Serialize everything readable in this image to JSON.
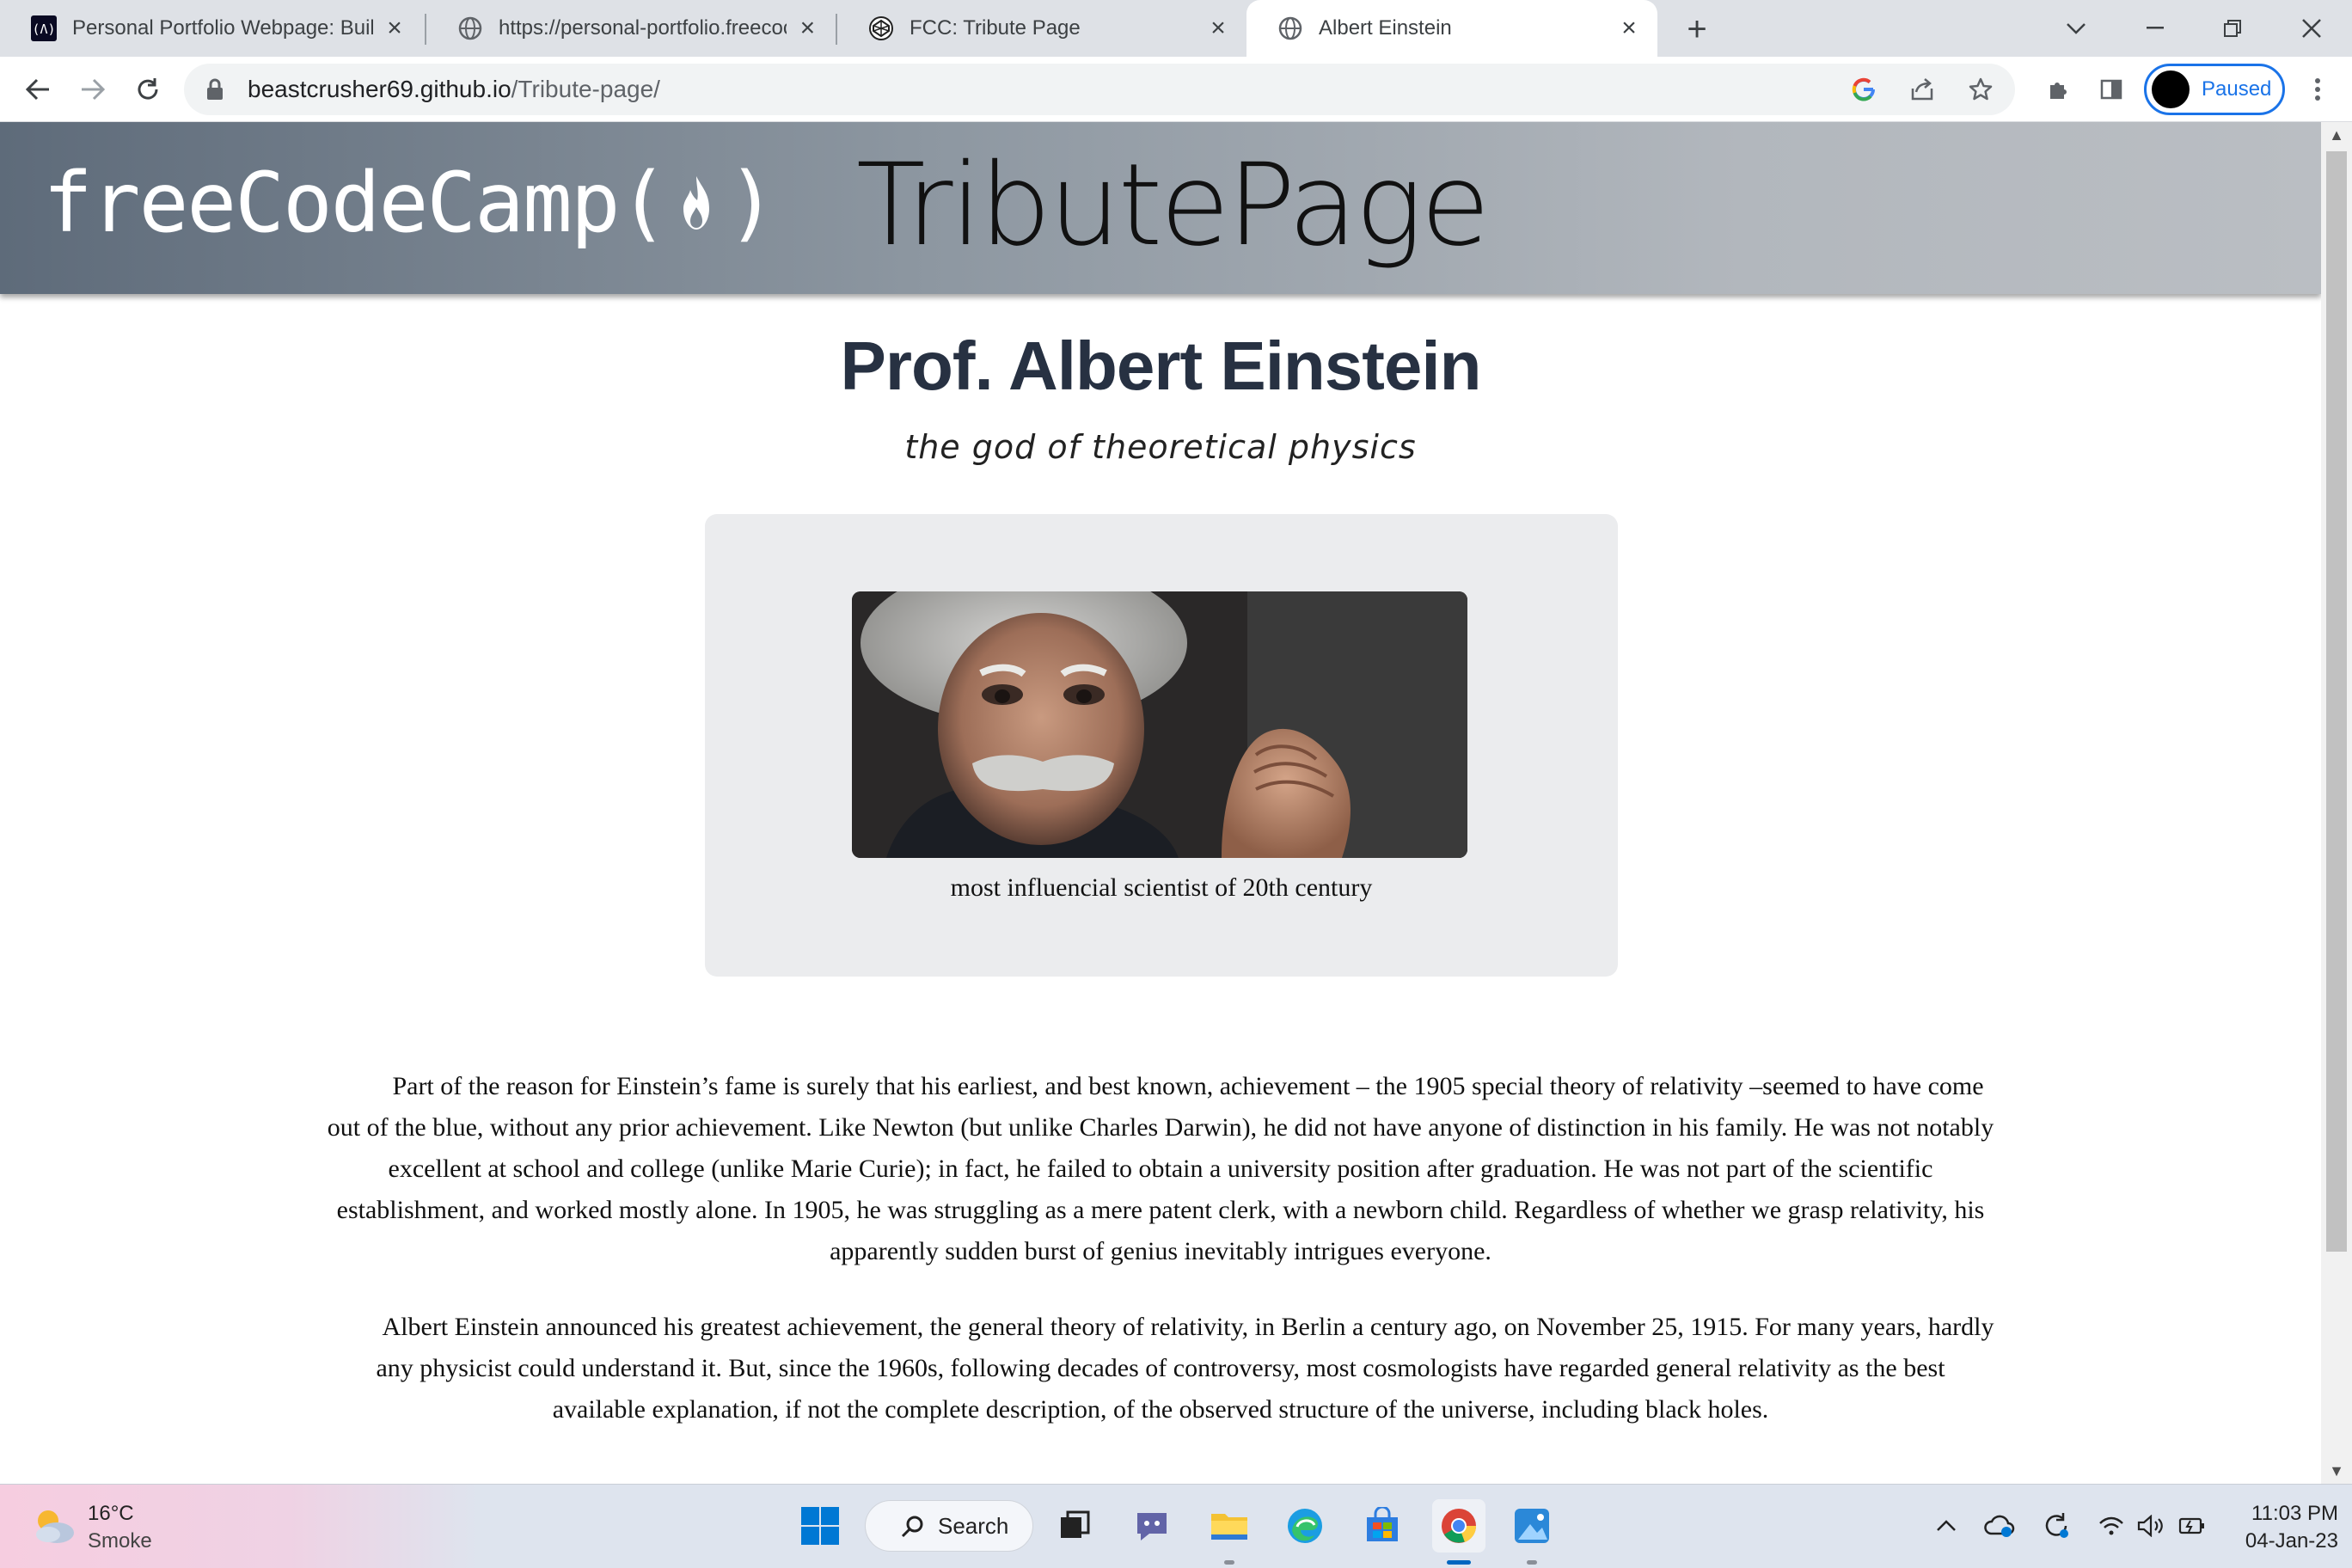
{
  "browser": {
    "tabs": [
      {
        "title": "Personal Portfolio Webpage: Buil",
        "icon": "freecodecamp-icon",
        "active": false
      },
      {
        "title": "https://personal-portfolio.freecoc",
        "icon": "globe-icon",
        "active": false
      },
      {
        "title": "FCC: Tribute Page",
        "icon": "codepen-icon",
        "active": false
      },
      {
        "title": "Albert Einstein",
        "icon": "globe-icon",
        "active": true
      }
    ],
    "url_host": "beastcrusher69.github.io",
    "url_path": "/Tribute-page/",
    "profile_label": "Paused"
  },
  "page": {
    "banner": {
      "logo_text": "freeCodeCamp(",
      "logo_close": ")",
      "title": "TributePage"
    },
    "title": "Prof. Albert Einstein",
    "subtitle": "the god of theoretical physics",
    "image_caption": "most influencial scientist of 20th century",
    "paragraphs": [
      "Part of the reason for Einstein’s fame is surely that his earliest, and best known, achievement – the 1905 special theory of relativity –seemed to have come out of the blue, without any prior achievement. Like Newton (but unlike Charles Darwin), he did not have anyone of distinction in his family. He was not notably excellent at school and college (unlike Marie Curie); in fact, he failed to obtain a university position after graduation. He was not part of the scientific establishment, and worked mostly alone. In 1905, he was struggling as a mere patent clerk, with a newborn child. Regardless of whether we grasp relativity, his apparently sudden burst of genius inevitably intrigues everyone.",
      "Albert Einstein announced his greatest achievement, the general theory of relativity, in Berlin a century ago, on November 25, 1915. For many years, hardly any physicist could understand it. But, since the 1960s, following decades of controversy, most cosmologists have regarded general relativity as the best available explanation, if not the complete description, of the observed structure of the universe, including black holes."
    ]
  },
  "taskbar": {
    "weather_temp": "16°C",
    "weather_cond": "Smoke",
    "search_label": "Search",
    "time": "11:03 PM",
    "date": "04-Jan-23"
  },
  "colors": {
    "accent": "#1a73e8",
    "heading": "#273142",
    "card_bg": "#ebecee"
  }
}
